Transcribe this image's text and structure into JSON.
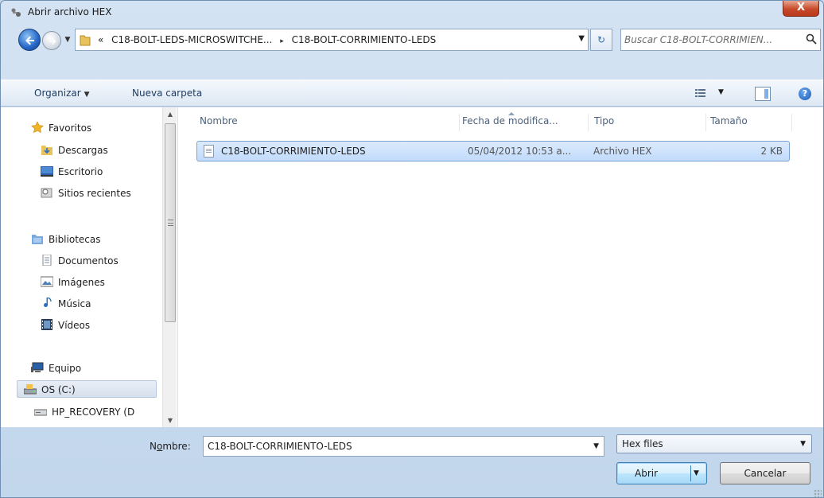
{
  "window": {
    "title": "Abrir archivo HEX",
    "close_label": "X"
  },
  "navigation": {
    "breadcrumbs": [
      "«",
      "C18-BOLT-LEDS-MICROSWITCHE...",
      "C18-BOLT-CORRIMIENTO-LEDS"
    ],
    "breadcrumb_separator": "▸",
    "search_placeholder": "Buscar C18-BOLT-CORRIMIEN..."
  },
  "toolbar": {
    "organize_label": "Organizar",
    "new_folder_label": "Nueva carpeta"
  },
  "sidebar": {
    "favorites": {
      "label": "Favoritos",
      "items": [
        "Descargas",
        "Escritorio",
        "Sitios recientes"
      ]
    },
    "libraries": {
      "label": "Bibliotecas",
      "items": [
        "Documentos",
        "Imágenes",
        "Música",
        "Vídeos"
      ]
    },
    "computer": {
      "label": "Equipo",
      "items": [
        "OS (C:)",
        "HP_RECOVERY (D"
      ]
    }
  },
  "file_list": {
    "columns": {
      "name": "Nombre",
      "date": "Fecha de modifica...",
      "type": "Tipo",
      "size": "Tamaño"
    },
    "rows": [
      {
        "name": "C18-BOLT-CORRIMIENTO-LEDS",
        "date": "05/04/2012 10:53 a...",
        "type": "Archivo HEX",
        "size": "2 KB"
      }
    ]
  },
  "footer": {
    "filename_label_prefix": "N",
    "filename_label_underlined": "o",
    "filename_label_suffix": "mbre:",
    "filename_value": "C18-BOLT-CORRIMIENTO-LEDS",
    "filetype_value": "Hex files",
    "open_label": "Abrir",
    "cancel_label": "Cancelar"
  },
  "colors": {
    "selection": "#c1dbfc",
    "frame": "#c9d8ea",
    "link": "#1e3a5f"
  }
}
